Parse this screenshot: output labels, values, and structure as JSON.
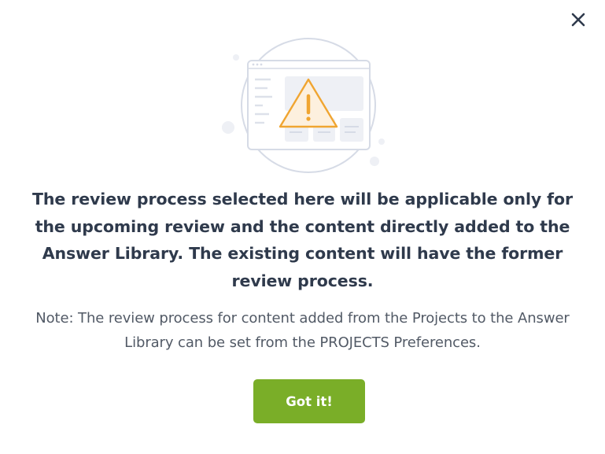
{
  "dialog": {
    "close_icon": "close-icon",
    "illustration_icon": "browser-warning-illustration",
    "headline": "The review process selected here will be applicable only for the upcoming review and the content directly added to the Answer Library. The existing content will have the former review process.",
    "note": "Note: The review process for content added from the Projects to the Answer Library can be set from the PROJECTS Preferences.",
    "confirm_label": "Got it!"
  },
  "colors": {
    "button_green": "#7aae28",
    "headline_text": "#2f3a4c",
    "note_text": "#525a66",
    "warning_orange": "#f0a531",
    "warning_fill": "#fdf0de",
    "illustration_outline": "#d6dbe6"
  }
}
